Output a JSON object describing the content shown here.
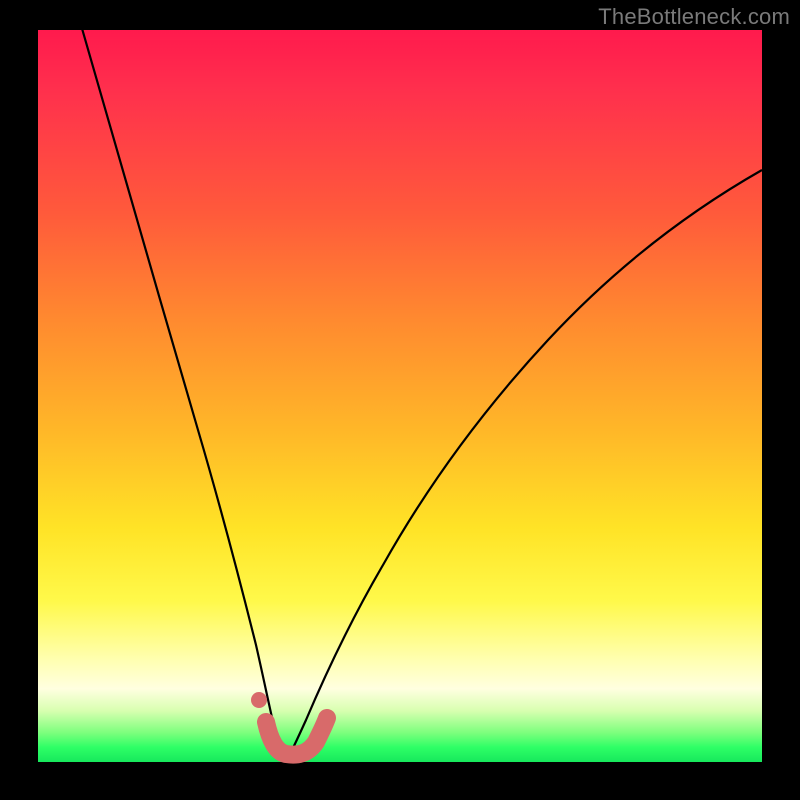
{
  "watermark": "TheBottleneck.com",
  "chart_data": {
    "type": "line",
    "title": "",
    "xlabel": "",
    "ylabel": "",
    "xlim": [
      0,
      100
    ],
    "ylim": [
      0,
      100
    ],
    "grid": false,
    "series": [
      {
        "name": "left-curve",
        "x": [
          6,
          10,
          14,
          18,
          22,
          26,
          28,
          30,
          31,
          32,
          33
        ],
        "y": [
          100,
          78,
          58,
          40,
          25,
          13,
          9,
          5,
          3,
          1,
          0
        ]
      },
      {
        "name": "right-curve",
        "x": [
          33,
          34,
          36,
          40,
          46,
          54,
          64,
          76,
          90,
          100
        ],
        "y": [
          0,
          1,
          4,
          10,
          20,
          32,
          45,
          58,
          70,
          78
        ]
      },
      {
        "name": "bottleneck-marker",
        "x": [
          30,
          31,
          33,
          35,
          37,
          38.5
        ],
        "y": [
          4,
          2,
          0.5,
          0.5,
          1.5,
          4
        ]
      }
    ],
    "annotations": [
      {
        "name": "marker-dot",
        "x": 29.2,
        "y": 7.5
      }
    ],
    "background_gradient": {
      "top": "#ff1a4d",
      "mid_upper": "#ff8b2f",
      "mid": "#ffe326",
      "mid_lower": "#ffffe0",
      "bottom": "#17e85c"
    }
  }
}
